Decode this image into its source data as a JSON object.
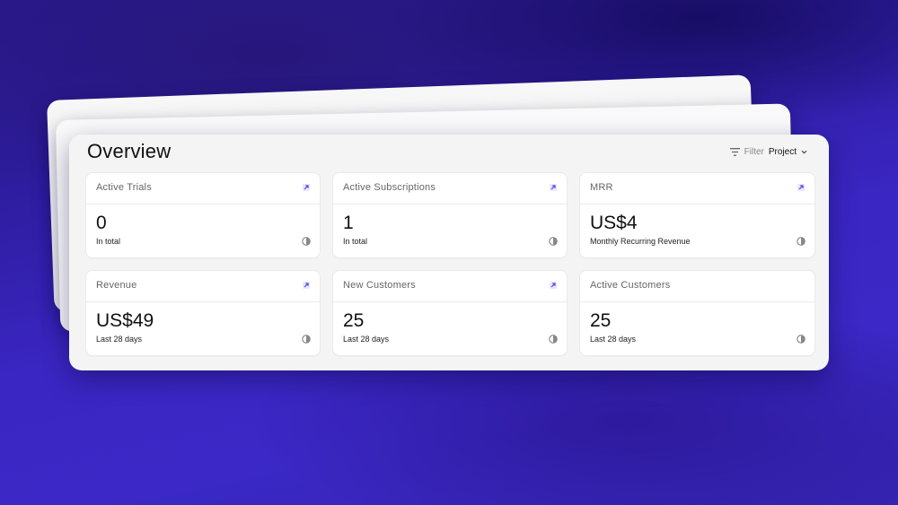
{
  "header": {
    "title": "Overview",
    "filter_label": "Filter",
    "filter_value": "Project"
  },
  "colors": {
    "accent": "#3b28c6",
    "link_icon": "#4f46e5"
  },
  "metrics": [
    {
      "title": "Active Trials",
      "value": "0",
      "caption": "In total",
      "has_open_icon": true
    },
    {
      "title": "Active Subscriptions",
      "value": "1",
      "caption": "In total",
      "has_open_icon": true
    },
    {
      "title": "MRR",
      "value": "US$4",
      "caption": "Monthly Recurring Revenue",
      "has_open_icon": true
    },
    {
      "title": "Revenue",
      "value": "US$49",
      "caption": "Last 28 days",
      "has_open_icon": true
    },
    {
      "title": "New Customers",
      "value": "25",
      "caption": "Last 28 days",
      "has_open_icon": true
    },
    {
      "title": "Active Customers",
      "value": "25",
      "caption": "Last 28 days",
      "has_open_icon": false
    }
  ]
}
